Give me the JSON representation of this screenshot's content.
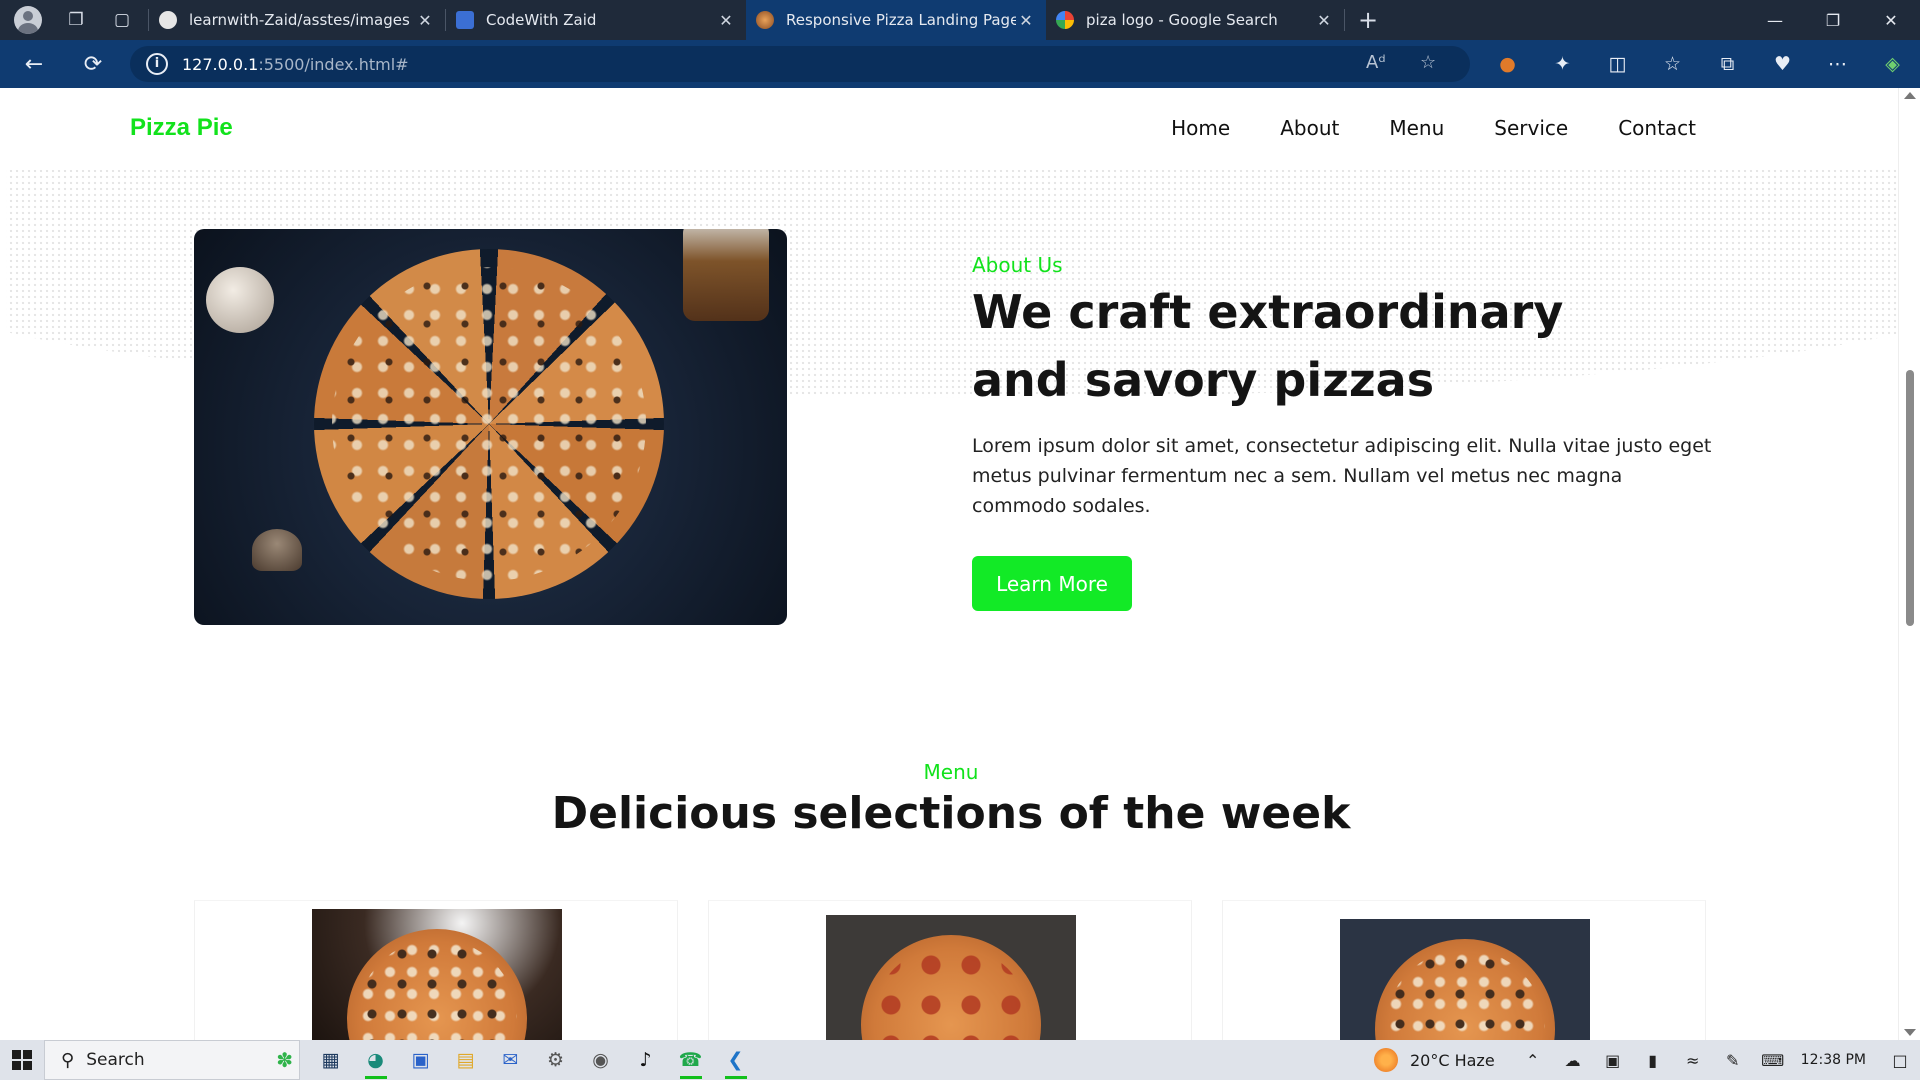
{
  "browser": {
    "tabs": [
      {
        "label": "learnwith-Zaid/asstes/images at",
        "favicon": "github-icon",
        "active": false
      },
      {
        "label": "CodeWith Zaid",
        "favicon": "monitor-icon",
        "active": false
      },
      {
        "label": "Responsive Pizza Landing Page",
        "favicon": "pizza-icon",
        "active": true
      },
      {
        "label": "piza logo - Google Search",
        "favicon": "google-icon",
        "active": false
      }
    ],
    "new_tab": "+",
    "url_host": "127.0.0.1",
    "url_rest": ":5500/index.html#"
  },
  "site": {
    "logo": "Pizza Pie",
    "nav": [
      "Home",
      "About",
      "Menu",
      "Service",
      "Contact"
    ],
    "accent_color": "#12e21c"
  },
  "about": {
    "subtitle": "About Us",
    "title": "We craft extraordinary and savory pizzas",
    "text": "Lorem ipsum dolor sit amet, consectetur adipiscing elit. Nulla vitae justo eget metus pulvinar fermentum nec a sem. Nullam vel metus nec magna commodo sodales.",
    "button": "Learn More"
  },
  "menu": {
    "subtitle": "Menu",
    "title": "Delicious selections of the week"
  },
  "taskbar": {
    "search_label": "Search",
    "weather": "20°C  Haze",
    "time": "12:38 PM"
  }
}
